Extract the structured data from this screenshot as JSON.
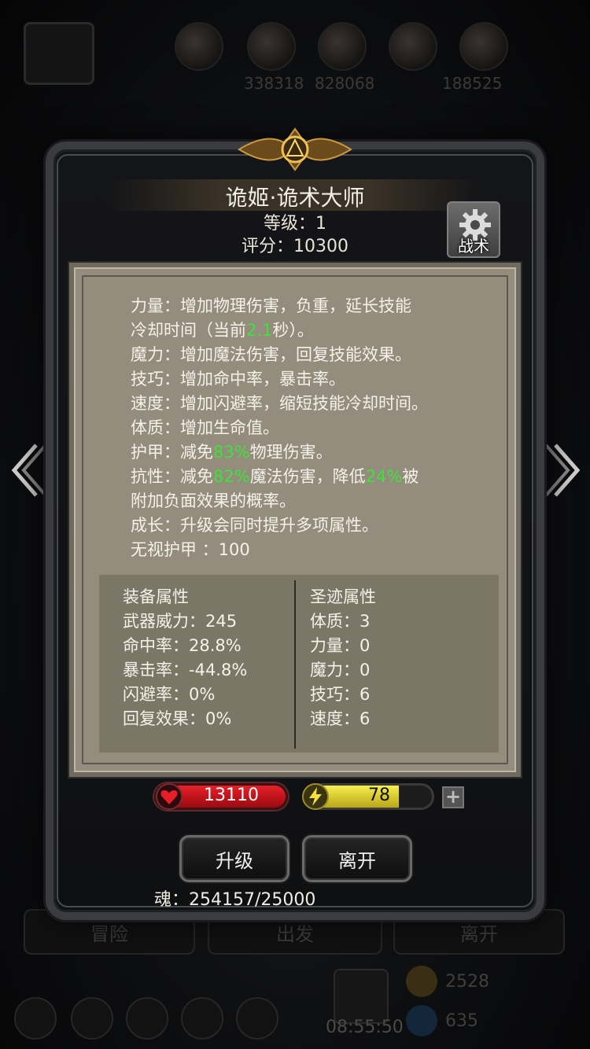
{
  "background": {
    "top_numbers": [
      "338318",
      "828068",
      "188525"
    ],
    "bottom_buttons": [
      "冒险",
      "出发",
      "离开"
    ],
    "resource": "2528",
    "resource2": "635",
    "clock": "08:55:50"
  },
  "panel": {
    "name": "诡姬·诡术大师",
    "level": "等级：1",
    "score": "评分：10300",
    "tactic_button": "战术"
  },
  "description": [
    {
      "parts": [
        {
          "t": "力量：增加物理伤害，负重，延长技能"
        }
      ]
    },
    {
      "parts": [
        {
          "t": "冷却时间（当前"
        },
        {
          "t": "2.1",
          "green": true
        },
        {
          "t": "秒）。"
        }
      ]
    },
    {
      "parts": [
        {
          "t": "魔力：增加魔法伤害，回复技能效果。"
        }
      ]
    },
    {
      "parts": [
        {
          "t": "技巧：增加命中率，暴击率。"
        }
      ]
    },
    {
      "parts": [
        {
          "t": "速度：增加闪避率，缩短技能冷却时间。"
        }
      ]
    },
    {
      "parts": [
        {
          "t": "体质：增加生命值。"
        }
      ]
    },
    {
      "parts": [
        {
          "t": "护甲：减免"
        },
        {
          "t": "83%",
          "green": true
        },
        {
          "t": "物理伤害。"
        }
      ]
    },
    {
      "parts": [
        {
          "t": "抗性：减免"
        },
        {
          "t": "82%",
          "green": true
        },
        {
          "t": "魔法伤害，降低"
        },
        {
          "t": "24%",
          "green": true
        },
        {
          "t": "被"
        }
      ]
    },
    {
      "parts": [
        {
          "t": "附加负面效果的概率。"
        }
      ]
    },
    {
      "parts": [
        {
          "t": "成长：升级会同时提升多项属性。"
        }
      ]
    },
    {
      "parts": [
        {
          "t": "无视护甲 ：100"
        }
      ]
    }
  ],
  "equipment": {
    "title": "装备属性",
    "rows": [
      "武器威力：245",
      "命中率：28.8%",
      "暴击率：-44.8%",
      "闪避率：0%",
      "回复效果：0%"
    ]
  },
  "relic": {
    "title": "圣迹属性",
    "rows": [
      "体质：3",
      "力量：0",
      "魔力：0",
      "技巧：6",
      "速度：6"
    ]
  },
  "bars": {
    "hp": "13110",
    "energy": "78",
    "energy_fill_fraction": 0.74,
    "plus": "+"
  },
  "buttons": {
    "upgrade": "升级",
    "leave": "离开"
  },
  "soul": "魂：254157/25000",
  "colors": {
    "highlight_green": "#3fe23a",
    "hp_red": "#e8202a",
    "energy_yellow": "#f6ee4e",
    "parchment": "#948c7c"
  },
  "icons": [
    "heart-icon",
    "lightning-icon",
    "gear-icon",
    "chevron-left-icon",
    "chevron-right-icon",
    "crest-emblem-icon"
  ]
}
